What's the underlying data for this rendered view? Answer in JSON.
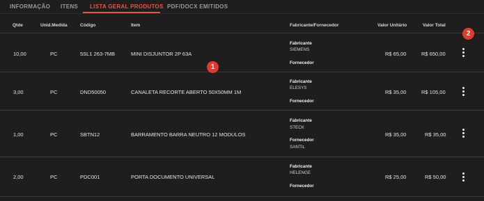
{
  "tabs": [
    {
      "label": "INFORMAÇÃO"
    },
    {
      "label": "ITENS"
    },
    {
      "label": "LISTA GERAL PRODUTOS"
    },
    {
      "label": "PDF/DOCX EMITIDOS"
    }
  ],
  "active_tab": "LISTA GERAL PRODUTOS",
  "columns": {
    "qtde": "Qtde",
    "unid": "Unid.Medida",
    "codigo": "Código",
    "item": "Item",
    "fabricante": "Fabricante/Fornecedor",
    "valor_unitario": "Valor Unitário",
    "valor_total": "Valor Total"
  },
  "labels": {
    "fabricante": "Fabricante",
    "fornecedor": "Fornecedor"
  },
  "rows": [
    {
      "qtde": "10,00",
      "unid": "PC",
      "codigo": "5SL1 263-7MB",
      "item": "MINI DISJUNTOR 2P 63A",
      "fabricante": "SIEMENS",
      "fornecedor": "",
      "valor_unitario": "R$ 65,00",
      "valor_total": "R$ 650,00"
    },
    {
      "qtde": "3,00",
      "unid": "PC",
      "codigo": "DND50050",
      "item": "CANALETA RECORTE ABERTO 50X50MM 1M",
      "fabricante": "ELESYS",
      "fornecedor": "",
      "valor_unitario": "R$ 35,00",
      "valor_total": "R$ 105,00"
    },
    {
      "qtde": "1,00",
      "unid": "PC",
      "codigo": "SBTN12",
      "item": "BARRAMENTO BARRA NEUTRO 12 MODULOS",
      "fabricante": "STECK",
      "fornecedor": "SANTIL",
      "valor_unitario": "R$ 35,00",
      "valor_total": "R$ 35,00"
    },
    {
      "qtde": "2,00",
      "unid": "PC",
      "codigo": "PDC001",
      "item": "PORTA DOCUMENTO UNIVERSAL",
      "fabricante": "HELENGE",
      "fornecedor": "",
      "valor_unitario": "R$ 25,00",
      "valor_total": "R$ 50,00"
    }
  ],
  "markers": {
    "one": "1",
    "two": "2"
  },
  "colors": {
    "accent": "#e8553d",
    "background": "#1e1e1e",
    "marker": "#e23b2e"
  },
  "icons": {
    "row_menu": "more-vertical-icon"
  }
}
